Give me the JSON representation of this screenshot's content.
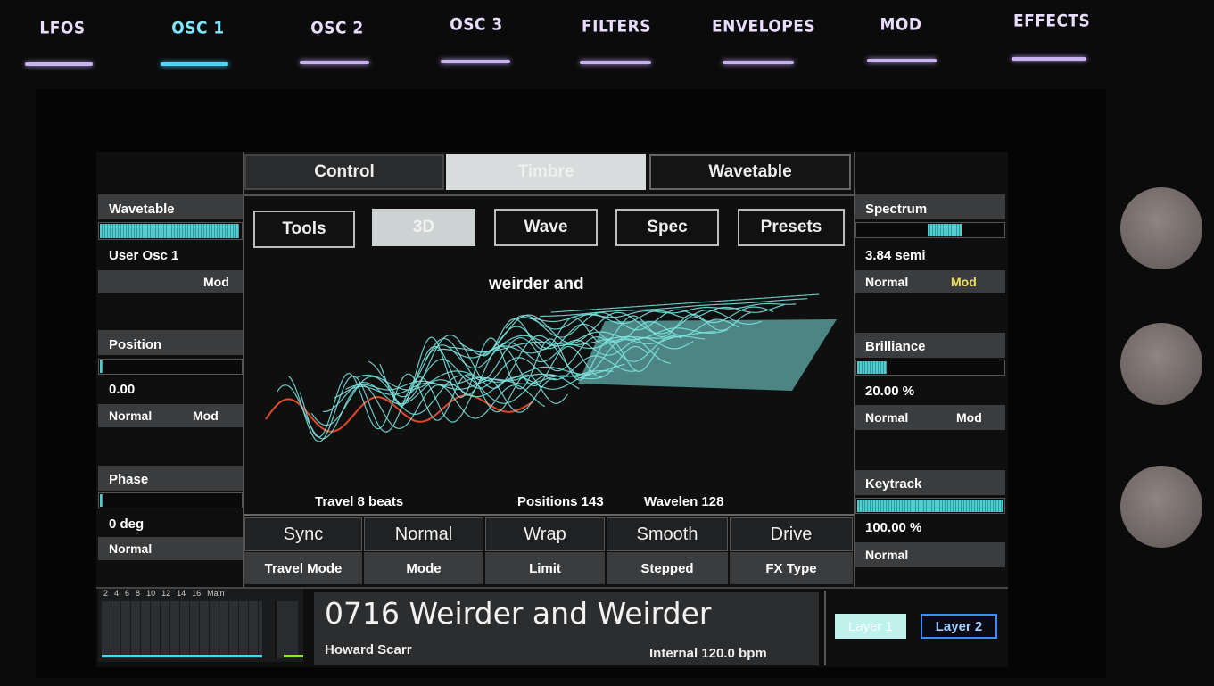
{
  "hardware_tabs": [
    {
      "label": "LFOS",
      "active": false
    },
    {
      "label": "OSC 1",
      "active": true
    },
    {
      "label": "OSC 2",
      "active": false
    },
    {
      "label": "OSC 3",
      "active": false
    },
    {
      "label": "FILTERS",
      "active": false
    },
    {
      "label": "ENVELOPES",
      "active": false
    },
    {
      "label": "MOD",
      "active": false
    },
    {
      "label": "EFFECTS",
      "active": false
    }
  ],
  "colors": {
    "accent": "#4fd3f5",
    "wave": "#7fe8e2",
    "mod_highlight": "#f0e060",
    "wave_edge": "#e04a2a"
  },
  "top_tabs": [
    "Control",
    "Timbre",
    "Wavetable"
  ],
  "selected_top_tab": "Timbre",
  "buttons": [
    "Tools",
    "3D",
    "Wave",
    "Spec",
    "Presets"
  ],
  "selected_button": "3D",
  "wavetable_title": "weirder and",
  "left_params": [
    {
      "name": "Wavetable",
      "value": "User Osc 1",
      "mode": "",
      "mod": "Mod",
      "level": 0.99
    },
    {
      "name": "Position",
      "value": "0.00",
      "mode": "Normal",
      "mod": "Mod",
      "level": 0.02
    },
    {
      "name": "Phase",
      "value": "0 deg",
      "mode": "Normal",
      "mod": "",
      "level": 0.02
    }
  ],
  "right_params": [
    {
      "name": "Spectrum",
      "value": "3.84 semi",
      "mode": "Normal",
      "mod": "Mod",
      "mod_active": true,
      "level": 0.55
    },
    {
      "name": "Brilliance",
      "value": "20.00 %",
      "mode": "Normal",
      "mod": "Mod",
      "mod_active": false,
      "level": 0.2
    },
    {
      "name": "Keytrack",
      "value": "100.00 %",
      "mode": "Normal",
      "mod": "",
      "mod_active": false,
      "level": 1.0
    }
  ],
  "info": {
    "travel": "Travel 8 beats",
    "positions": "Positions 143",
    "wavelen": "Wavelen 128"
  },
  "bottom_params": [
    {
      "value": "Sync",
      "label": "Travel Mode"
    },
    {
      "value": "Normal",
      "label": "Mode"
    },
    {
      "value": "Wrap",
      "label": "Limit"
    },
    {
      "value": "Smooth",
      "label": "Stepped"
    },
    {
      "value": "Drive",
      "label": "FX Type"
    }
  ],
  "meter_labels": [
    "2",
    "4",
    "6",
    "8",
    "10",
    "12",
    "14",
    "16",
    "Main"
  ],
  "patch": {
    "name": "0716 Weirder and Weirder",
    "author": "Howard Scarr",
    "tempo": "Internal 120.0 bpm"
  },
  "layers": [
    {
      "label": "Layer 1",
      "selected": true
    },
    {
      "label": "Layer 2",
      "selected": false
    }
  ]
}
